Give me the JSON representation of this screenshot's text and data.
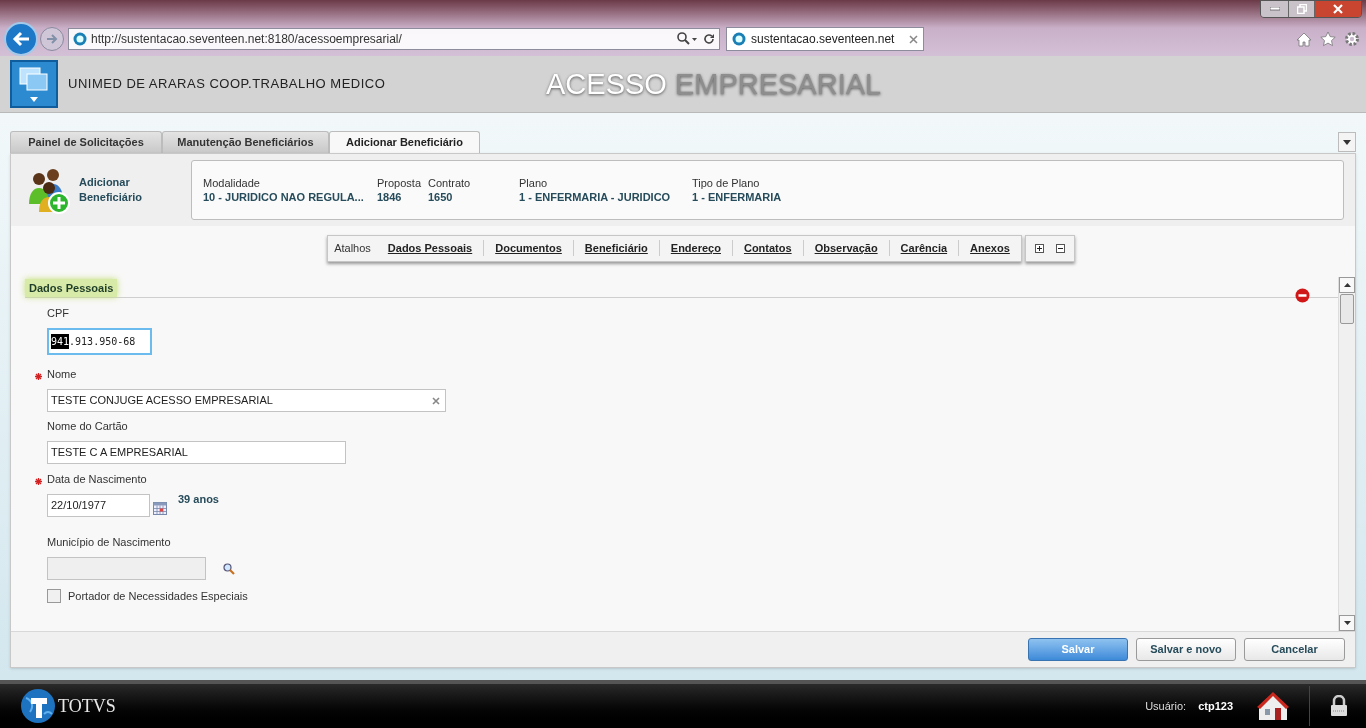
{
  "browser": {
    "address": "http://sustentacao.seventeen.net:8180/acessoempresarial/",
    "tab_title": "sustentacao.seventeen.net"
  },
  "header": {
    "company": "UNIMED DE ARARAS COOP.TRABALHO MEDICO",
    "title_first": "ACESSO",
    "title_second": "EMPRESARIAL"
  },
  "tabs": [
    {
      "label": "Painel de Solicitações",
      "selected": false
    },
    {
      "label": "Manutenção Beneficiários",
      "selected": false
    },
    {
      "label": "Adicionar Beneficiário",
      "selected": true
    }
  ],
  "summary": {
    "title": "Adicionar Beneficiário",
    "fields": [
      {
        "label": "Modalidade",
        "value": "10 - JURIDICO NAO REGULA..."
      },
      {
        "label": "Proposta",
        "value": "1846"
      },
      {
        "label": "Contrato",
        "value": "1650"
      },
      {
        "label": "Plano",
        "value": "1 - ENFERMARIA - JURIDICO"
      },
      {
        "label": "Tipo de Plano",
        "value": "1 - ENFERMARIA"
      }
    ]
  },
  "shortcuts": {
    "label": "Atalhos",
    "links": [
      "Dados Pessoais",
      "Documentos",
      "Beneficiário",
      "Endereço",
      "Contatos",
      "Observação",
      "Carência",
      "Anexos"
    ]
  },
  "section": {
    "title": "Dados Pessoais"
  },
  "fields": [
    {
      "kind": "cpf",
      "label": "CPF",
      "required": false,
      "value_parts": [
        {
          "text": "941",
          "selected": true
        },
        {
          "text": ".913.950-68",
          "selected": false
        }
      ]
    },
    {
      "kind": "text",
      "label": "Nome",
      "required": true,
      "value": "TESTE CONJUGE ACESSO EMPRESARIAL",
      "clearable": true
    },
    {
      "kind": "text",
      "label": "Nome do Cartão",
      "required": false,
      "value": "TESTE C A EMPRESARIAL",
      "clearable": false
    },
    {
      "kind": "date",
      "label": "Data de Nascimento",
      "required": true,
      "value": "22/10/1977",
      "age": "39 anos"
    },
    {
      "kind": "lookup",
      "label": "Município de Nascimento",
      "required": false,
      "disabled": true
    },
    {
      "kind": "checkbox",
      "label": "Portador de Necessidades Especiais",
      "checked": false
    }
  ],
  "buttons": [
    {
      "label": "Salvar",
      "primary": true
    },
    {
      "label": "Salvar e novo",
      "primary": false
    },
    {
      "label": "Cancelar",
      "primary": false
    }
  ],
  "footer": {
    "brand": "TOTVS",
    "user_label": "Usuário:",
    "user": "ctp123"
  }
}
